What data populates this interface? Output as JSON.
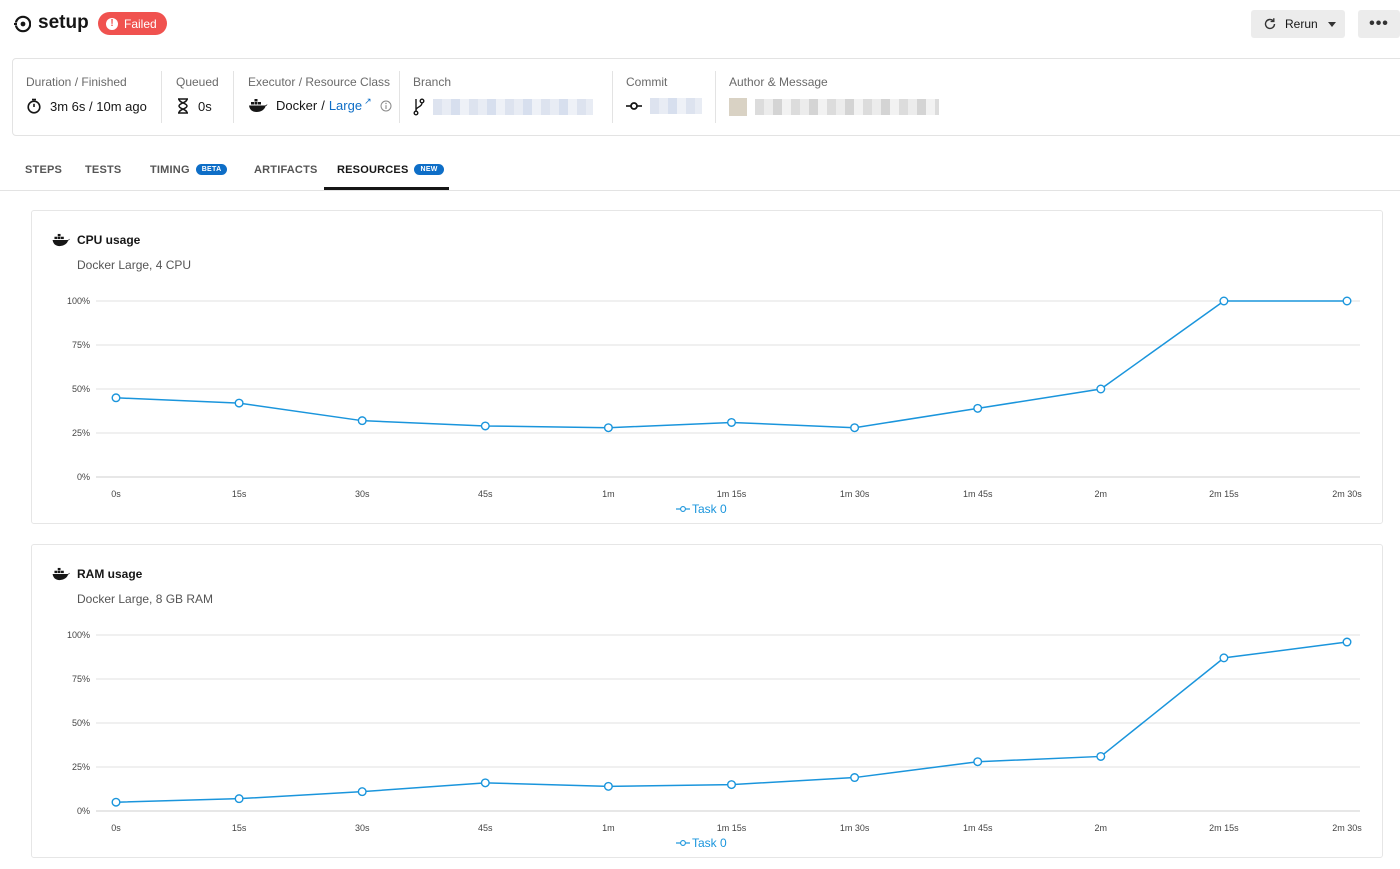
{
  "header": {
    "job_name": "setup",
    "status": "Failed",
    "rerun_label": "Rerun",
    "more_label": "•••"
  },
  "meta": {
    "duration_label": "Duration / Finished",
    "duration_value": "3m 6s / 10m ago",
    "queued_label": "Queued",
    "queued_value": "0s",
    "executor_label": "Executor / Resource Class",
    "executor_value": "Docker",
    "executor_sep": "/",
    "resource_class": "Large",
    "branch_label": "Branch",
    "commit_label": "Commit",
    "author_label": "Author & Message"
  },
  "tabs": [
    {
      "label": "STEPS"
    },
    {
      "label": "TESTS"
    },
    {
      "label": "TIMING",
      "badge": "BETA"
    },
    {
      "label": "ARTIFACTS"
    },
    {
      "label": "RESOURCES",
      "badge": "NEW"
    }
  ],
  "cards": {
    "cpu": {
      "title": "CPU usage",
      "subtitle": "Docker Large, 4 CPU"
    },
    "ram": {
      "title": "RAM usage",
      "subtitle": "Docker Large, 8 GB RAM"
    }
  },
  "colors": {
    "accent": "#0e6ec7",
    "failed": "#f0524f",
    "series": "#1a95dc"
  },
  "chart_data": [
    {
      "type": "line",
      "x": [
        "0s",
        "15s",
        "30s",
        "45s",
        "1m",
        "1m 15s",
        "1m 30s",
        "1m 45s",
        "2m",
        "2m 15s",
        "2m 30s"
      ],
      "series": [
        {
          "name": "Task 0",
          "values": [
            45,
            42,
            32,
            29,
            28,
            31,
            28,
            39,
            50,
            100,
            100
          ]
        }
      ],
      "yticks": [
        "0%",
        "25%",
        "50%",
        "75%",
        "100%"
      ],
      "ylim": [
        0,
        100
      ],
      "grid": true,
      "legend": "bottom-center"
    },
    {
      "type": "line",
      "x": [
        "0s",
        "15s",
        "30s",
        "45s",
        "1m",
        "1m 15s",
        "1m 30s",
        "1m 45s",
        "2m",
        "2m 15s",
        "2m 30s"
      ],
      "series": [
        {
          "name": "Task 0",
          "values": [
            5,
            7,
            11,
            16,
            14,
            15,
            19,
            28,
            31,
            87,
            96
          ]
        }
      ],
      "yticks": [
        "0%",
        "25%",
        "50%",
        "75%",
        "100%"
      ],
      "ylim": [
        0,
        100
      ],
      "grid": true,
      "legend": "bottom-center"
    }
  ]
}
